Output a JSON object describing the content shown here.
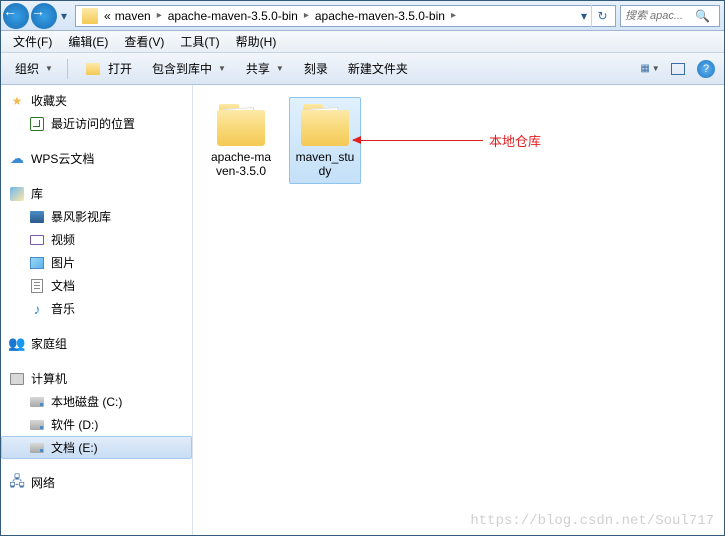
{
  "nav": {
    "breadcrumb_prefix": "«",
    "crumbs": [
      "maven",
      "apache-maven-3.5.0-bin",
      "apache-maven-3.5.0-bin"
    ],
    "search_placeholder": "搜索 apac..."
  },
  "menu": {
    "file": "文件(F)",
    "edit": "编辑(E)",
    "view": "查看(V)",
    "tools": "工具(T)",
    "help": "帮助(H)"
  },
  "toolbar": {
    "organize": "组织",
    "open": "打开",
    "include": "包含到库中",
    "share": "共享",
    "burn": "刻录",
    "newfolder": "新建文件夹"
  },
  "sidebar": {
    "favorites": {
      "label": "收藏夹",
      "recent": "最近访问的位置"
    },
    "wps": "WPS云文档",
    "libraries": {
      "label": "库",
      "storm": "暴风影视库",
      "video": "视频",
      "pictures": "图片",
      "documents": "文档",
      "music": "音乐"
    },
    "homegroup": "家庭组",
    "computer": {
      "label": "计算机",
      "c": "本地磁盘 (C:)",
      "d": "软件 (D:)",
      "e": "文档 (E:)"
    },
    "network": "网络"
  },
  "content": {
    "folders": [
      {
        "name": "apache-maven-3.5.0",
        "selected": false
      },
      {
        "name": "maven_study",
        "selected": true
      }
    ],
    "annotation": "本地仓库"
  },
  "watermark": "https://blog.csdn.net/Soul717"
}
